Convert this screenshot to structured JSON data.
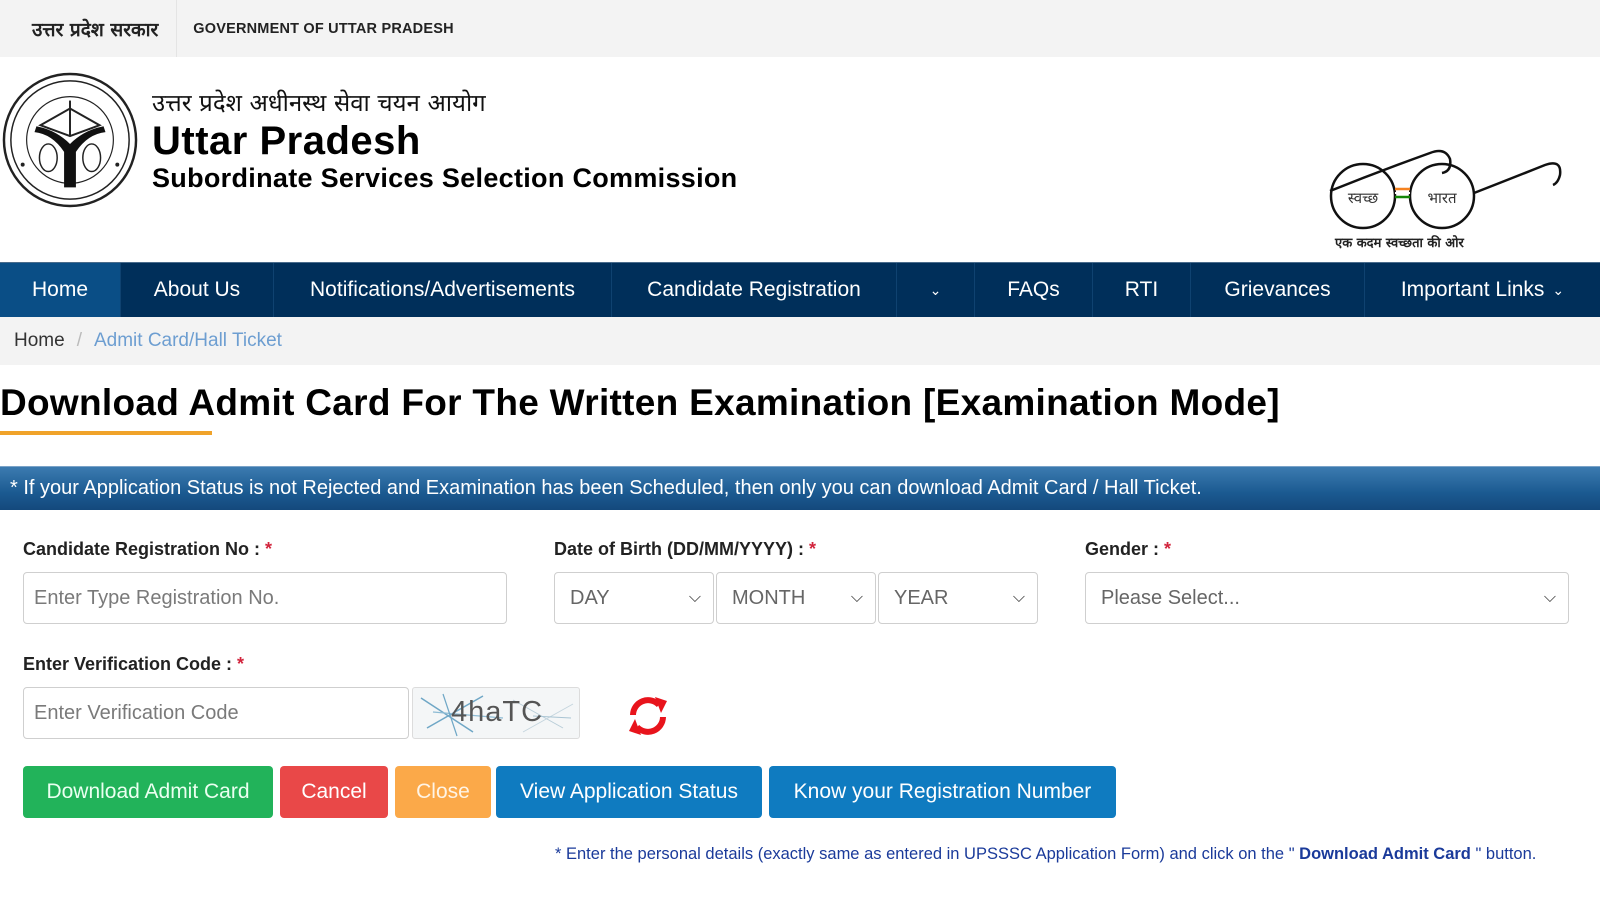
{
  "gov_bar": {
    "hindi": "उत्तर प्रदेश सरकार",
    "english": "GOVERNMENT OF UTTAR PRADESH"
  },
  "header": {
    "org_hindi": "उत्तर प्रदेश अधीनस्थ सेवा चयन आयोग",
    "org_title": "Uttar Pradesh",
    "org_subtitle": "Subordinate Services Selection Commission",
    "emblem_icon": "up-government-emblem-icon",
    "swachh_left": "स्वच्छ",
    "swachh_right": "भारत",
    "swachh_caption": "एक कदम स्वच्छता की ओर"
  },
  "nav": {
    "items": [
      {
        "label": "Home",
        "active": true
      },
      {
        "label": "About Us"
      },
      {
        "label": "Notifications/Advertisements"
      },
      {
        "label": "Candidate Registration"
      },
      {
        "label": ""
      },
      {
        "label": "FAQs"
      },
      {
        "label": "RTI"
      },
      {
        "label": "Grievances"
      },
      {
        "label": "Important Links"
      }
    ],
    "chevron": "⌄"
  },
  "breadcrumb": {
    "home": "Home",
    "separator": "/",
    "current": "Admit Card/Hall Ticket"
  },
  "page": {
    "title": "Download Admit Card For The Written Examination [Examination Mode]",
    "banner": "* If your Application Status is not Rejected and Examination has been Scheduled, then only you can download Admit Card / Hall Ticket."
  },
  "form": {
    "registration": {
      "label": "Candidate Registration No :",
      "required": "*",
      "placeholder": "Enter Type Registration No.",
      "value": ""
    },
    "dob": {
      "label": "Date of Birth (DD/MM/YYYY) :",
      "required": "*",
      "day": "DAY",
      "month": "MONTH",
      "year": "YEAR"
    },
    "gender": {
      "label": "Gender :",
      "required": "*",
      "selected": "Please Select..."
    },
    "verification": {
      "label": "Enter Verification Code :",
      "required": "*",
      "placeholder": "Enter Verification Code",
      "value": "",
      "captcha_text": "4haTC",
      "refresh_icon": "refresh-icon"
    }
  },
  "buttons": {
    "download": "Download Admit Card",
    "cancel": "Cancel",
    "close": "Close",
    "view_status": "View Application Status",
    "know_reg": "Know your Registration Number"
  },
  "footnote": {
    "prefix": "* Enter the personal details (exactly same as entered in UPSSSC Application Form) and click on the \"",
    "emphasis": " Download Admit Card ",
    "suffix": "\" button."
  },
  "colors": {
    "nav_bg": "#002f5a",
    "nav_active": "#0a4e86",
    "accent_underline": "#f0a32a",
    "download_btn": "#22b35a",
    "cancel_btn": "#e94848",
    "close_btn": "#fba949",
    "primary_btn": "#0f7bc0",
    "required": "#d2243c",
    "refresh": "#e8141c"
  }
}
